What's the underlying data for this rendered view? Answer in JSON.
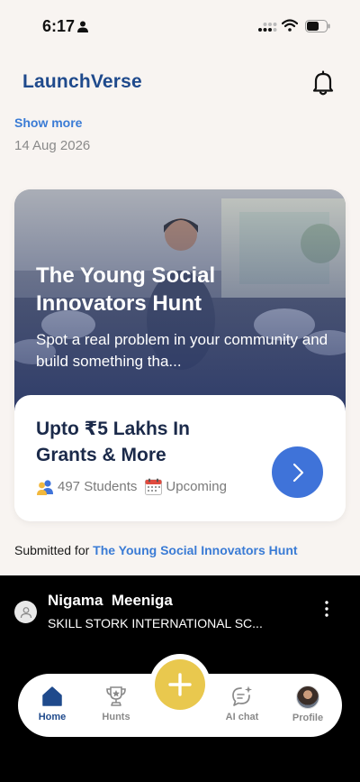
{
  "status_bar": {
    "time": "6:17"
  },
  "header": {
    "app_title": "LaunchVerse"
  },
  "feed": {
    "show_more_label": "Show more",
    "post_date": "14 Aug 2026"
  },
  "hunt_card": {
    "title": "The Young Social Innovators Hunt",
    "description": "Spot a real problem in your community and build something tha...",
    "grant": "Upto ₹5 Lakhs In Grants & More",
    "students": "497 Students",
    "status": "Upcoming"
  },
  "submission": {
    "prefix": "Submitted for ",
    "hunt_name": "The Young Social Innovators Hunt"
  },
  "video_post": {
    "user_name": "Nigama  Meeniga",
    "school": "SKILL STORK INTERNATIONAL SC..."
  },
  "bottom_nav": {
    "items": [
      {
        "label": "Home",
        "icon": "home-icon",
        "active": true
      },
      {
        "label": "Hunts",
        "icon": "trophy-icon",
        "active": false
      },
      {
        "label": "AI chat",
        "icon": "ai-chat-icon",
        "active": false
      },
      {
        "label": "Profile",
        "icon": "profile-avatar",
        "active": false
      }
    ]
  },
  "colors": {
    "brand": "#1f4a8c",
    "link": "#3a7bd5",
    "arrow_button": "#3f73d9",
    "add_button": "#e9c84e",
    "background": "#f8f4f1"
  }
}
